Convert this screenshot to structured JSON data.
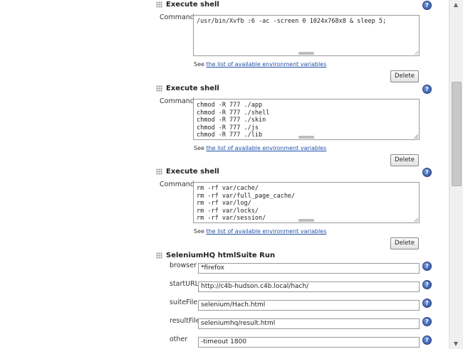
{
  "sections": [
    {
      "title": "Execute shell",
      "command_label": "Command",
      "command": "/usr/bin/Xvfb :6 -ac -screen 0 1024x768x8 & sleep 5;",
      "see_prefix": "See",
      "env_link": "the list of available environment variables",
      "delete_label": "Delete"
    },
    {
      "title": "Execute shell",
      "command_label": "Command",
      "command": "chmod -R 777 ./app\nchmod -R 777 ./shell\nchmod -R 777 ./skin\nchmod -R 777 ./js\nchmod -R 777 ./lib",
      "see_prefix": "See",
      "env_link": "the list of available environment variables",
      "delete_label": "Delete"
    },
    {
      "title": "Execute shell",
      "command_label": "Command",
      "command": "rm -rf var/cache/\nrm -rf var/full_page_cache/\nrm -rf var/log/\nrm -rf var/locks/\nrm -rf var/session/",
      "see_prefix": "See",
      "env_link": "the list of available environment variables",
      "delete_label": "Delete"
    }
  ],
  "selenium": {
    "title": "SeleniumHQ htmlSuite Run",
    "fields": [
      {
        "label": "browser",
        "value": "*firefox"
      },
      {
        "label": "startURL",
        "value": "http://c4b-hudson.c4b.local/hach/"
      },
      {
        "label": "suiteFile",
        "value": "selenium/Hach.html"
      },
      {
        "label": "resultFile",
        "value": "seleniumhq/result.html"
      },
      {
        "label": "other",
        "value": "-timeout 1800"
      }
    ]
  },
  "icons": {
    "help": "help-icon",
    "drag": "drag-handle-icon"
  },
  "colors": {
    "link": "#2050a8",
    "help": "#2a4f9e"
  }
}
